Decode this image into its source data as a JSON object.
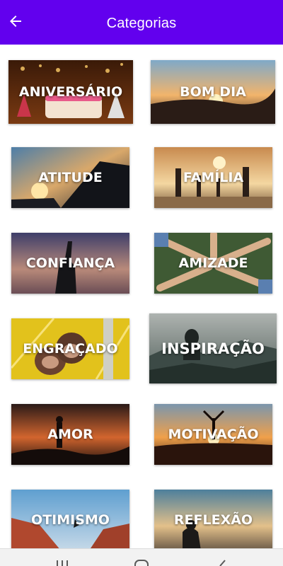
{
  "appbar": {
    "title": "Categorias",
    "back_icon": "arrow-left-icon",
    "color": "#6200ee"
  },
  "categories": [
    {
      "label": "ANIVERSÁRIO"
    },
    {
      "label": "BOM DIA"
    },
    {
      "label": "ATITUDE"
    },
    {
      "label": "FAMÍLIA"
    },
    {
      "label": "CONFIANÇA"
    },
    {
      "label": "AMIZADE"
    },
    {
      "label": "ENGRAÇADO"
    },
    {
      "label": "INSPIRAÇÃO"
    },
    {
      "label": "AMOR"
    },
    {
      "label": "MOTIVAÇÃO"
    },
    {
      "label": "OTIMISMO"
    },
    {
      "label": "REFLEXÃO"
    }
  ],
  "navbar": {
    "icons": [
      "recent-apps-icon",
      "home-icon",
      "back-icon"
    ]
  }
}
